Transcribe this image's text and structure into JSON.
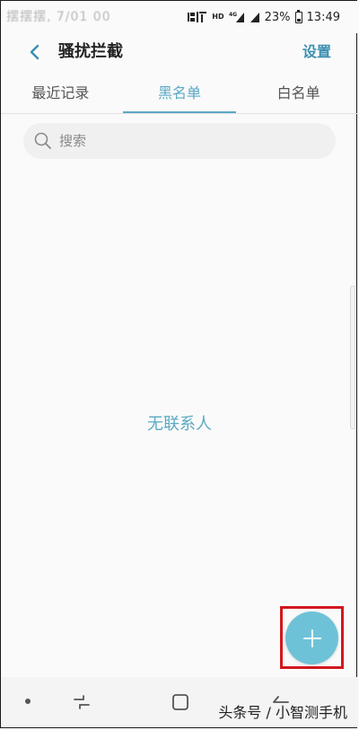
{
  "status_bar": {
    "left_text": "摆摆摆, 7/01 00",
    "right_icons": [
      "signal-icon",
      "sim-icon",
      "hd-icon",
      "4g-icon",
      "wifi-signal-icon",
      "cell-signal-icon"
    ],
    "hd_label": "HD",
    "lte_label": "4G",
    "battery_percent": "23%",
    "time": "13:49"
  },
  "app_bar": {
    "title": "骚扰拦截",
    "settings_label": "设置"
  },
  "tabs": [
    {
      "label": "最近记录",
      "active": false
    },
    {
      "label": "黑名单",
      "active": true
    },
    {
      "label": "白名单",
      "active": false
    }
  ],
  "search": {
    "placeholder": "搜索"
  },
  "empty_state": {
    "message": "无联系人"
  },
  "fab": {
    "icon": "plus-icon"
  },
  "nav_bar": {
    "watermark": "头条号 / 小智测手机"
  },
  "colors": {
    "accent": "#5ba8c4",
    "fab": "#6ec2d8",
    "highlight": "#d2181e"
  }
}
